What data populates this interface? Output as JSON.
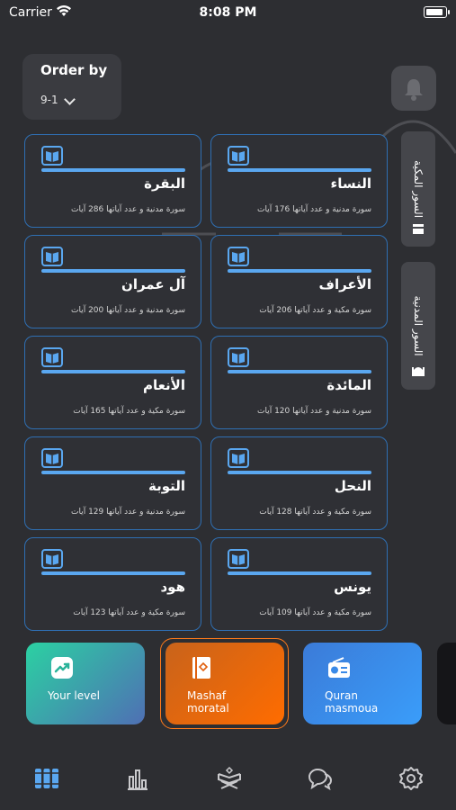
{
  "status": {
    "carrier": "Carrier",
    "time": "8:08 PM"
  },
  "order": {
    "title": "Order by",
    "value": "9-1"
  },
  "side_tabs": [
    {
      "label": "السور المكية",
      "icon": "kaaba-icon"
    },
    {
      "label": "السور المدنية",
      "icon": "mosque-icon"
    }
  ],
  "surahs": [
    {
      "name": "النساء",
      "desc": "سورة مدنية و عدد آياتها 176 آيات"
    },
    {
      "name": "البقرة",
      "desc": "سورة مدنية و عدد آياتها 286 آيات"
    },
    {
      "name": "الأعراف",
      "desc": "سورة مكية و عدد آياتها 206 آيات"
    },
    {
      "name": "آل عمران",
      "desc": "سورة مدنية و عدد آياتها 200 آيات"
    },
    {
      "name": "المائدة",
      "desc": "سورة مدنية و عدد آياتها 120 آيات"
    },
    {
      "name": "الأنعام",
      "desc": "سورة مكية و عدد آياتها 165 آيات"
    },
    {
      "name": "النحل",
      "desc": "سورة مكية و عدد آياتها 128 آيات"
    },
    {
      "name": "التوبة",
      "desc": "سورة مدنية و عدد آياتها 129 آيات"
    },
    {
      "name": "يونس",
      "desc": "سورة مكية و عدد آياتها 109 آيات"
    },
    {
      "name": "هود",
      "desc": "سورة مكية و عدد آياتها 123 آيات"
    }
  ],
  "features": [
    {
      "label": "Your level",
      "icon": "trend-up-icon"
    },
    {
      "label": "Mashaf moratal",
      "icon": "quran-book-icon"
    },
    {
      "label": "Quran masmoua",
      "icon": "radio-icon"
    }
  ],
  "tabs": [
    {
      "icon": "library-icon"
    },
    {
      "icon": "stats-icon"
    },
    {
      "icon": "quran-stand-icon"
    },
    {
      "icon": "chat-bubbles-icon"
    },
    {
      "icon": "settings-icon"
    }
  ],
  "colors": {
    "background": "#2d2e32",
    "card_border": "#2f6fb3",
    "accent_blue": "#5aa7f0",
    "level_gradient": [
      "#2bd1a2",
      "#4f6fb4"
    ],
    "mashaf_gradient": [
      "#c8631b",
      "#ff6c00"
    ],
    "masmoua_gradient": [
      "#3b7bd8",
      "#3a9dfa"
    ]
  }
}
